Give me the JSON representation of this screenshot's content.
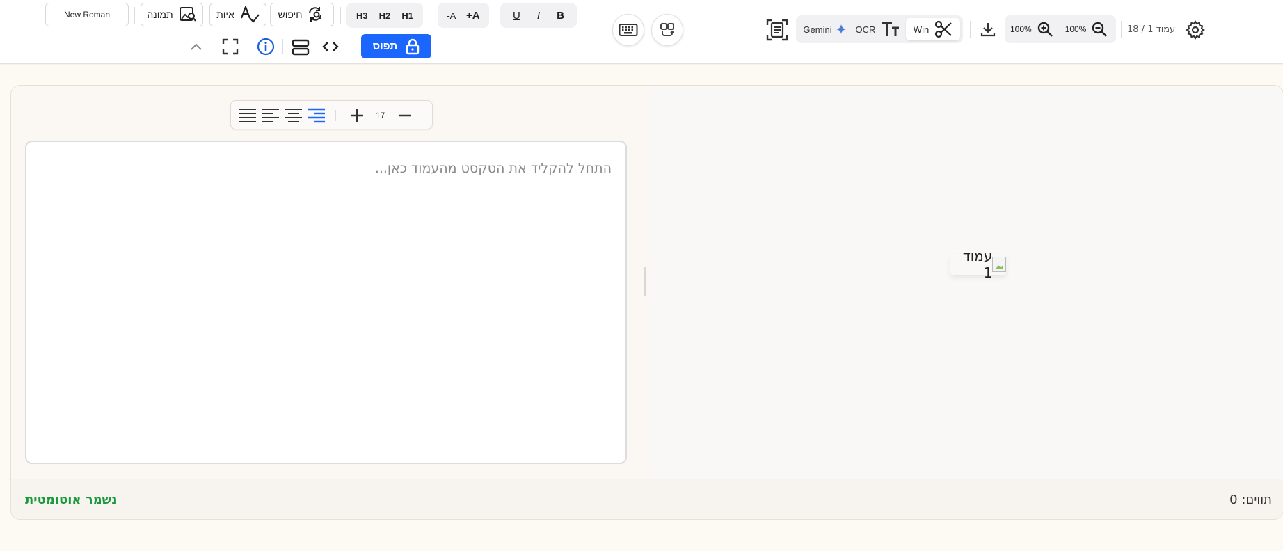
{
  "toolbar": {
    "font_name": "New Roman",
    "image_label": "תמונה",
    "spelling_label": "איות",
    "search_label": "חיפוש",
    "h3": "H3",
    "h2": "H2",
    "h1": "H1",
    "font_smaller": "-A",
    "font_larger": "+A",
    "underline": "U",
    "italic": "I",
    "bold": "B",
    "lock_label": "תפוס",
    "gemini_label": "Gemini",
    "ocr_label": "OCR",
    "win_label": "Win",
    "zoom_in_value": "100%",
    "zoom_out_value": "100%",
    "page_indicator": "עמוד 1 / 18"
  },
  "format_bar": {
    "font_size": "17"
  },
  "editor": {
    "placeholder": "התחל להקליד את הטקסט מהעמוד כאן..."
  },
  "preview": {
    "page_label": "עמוד 1"
  },
  "status": {
    "words": "תווים: 0",
    "autosave": "נשמר אוטומטית"
  },
  "colors": {
    "accent": "#1a66ff",
    "autosave": "#1a9a3c",
    "info": "#1a5fd6"
  },
  "icons": [
    "image-search-icon",
    "spellcheck-icon",
    "find-replace-icon",
    "lock-icon",
    "expand-icon",
    "info-icon",
    "split-layout-icon",
    "code-icon",
    "chevron-up-icon",
    "keyboard-icon",
    "swap-icon",
    "document-scan-icon",
    "sparkle-icon",
    "text-size-icon",
    "scissors-icon",
    "download-icon",
    "zoom-in-icon",
    "zoom-out-icon",
    "gear-icon",
    "align-justify-icon",
    "align-left-icon",
    "align-center-icon",
    "align-right-icon",
    "plus-icon",
    "minus-icon"
  ]
}
